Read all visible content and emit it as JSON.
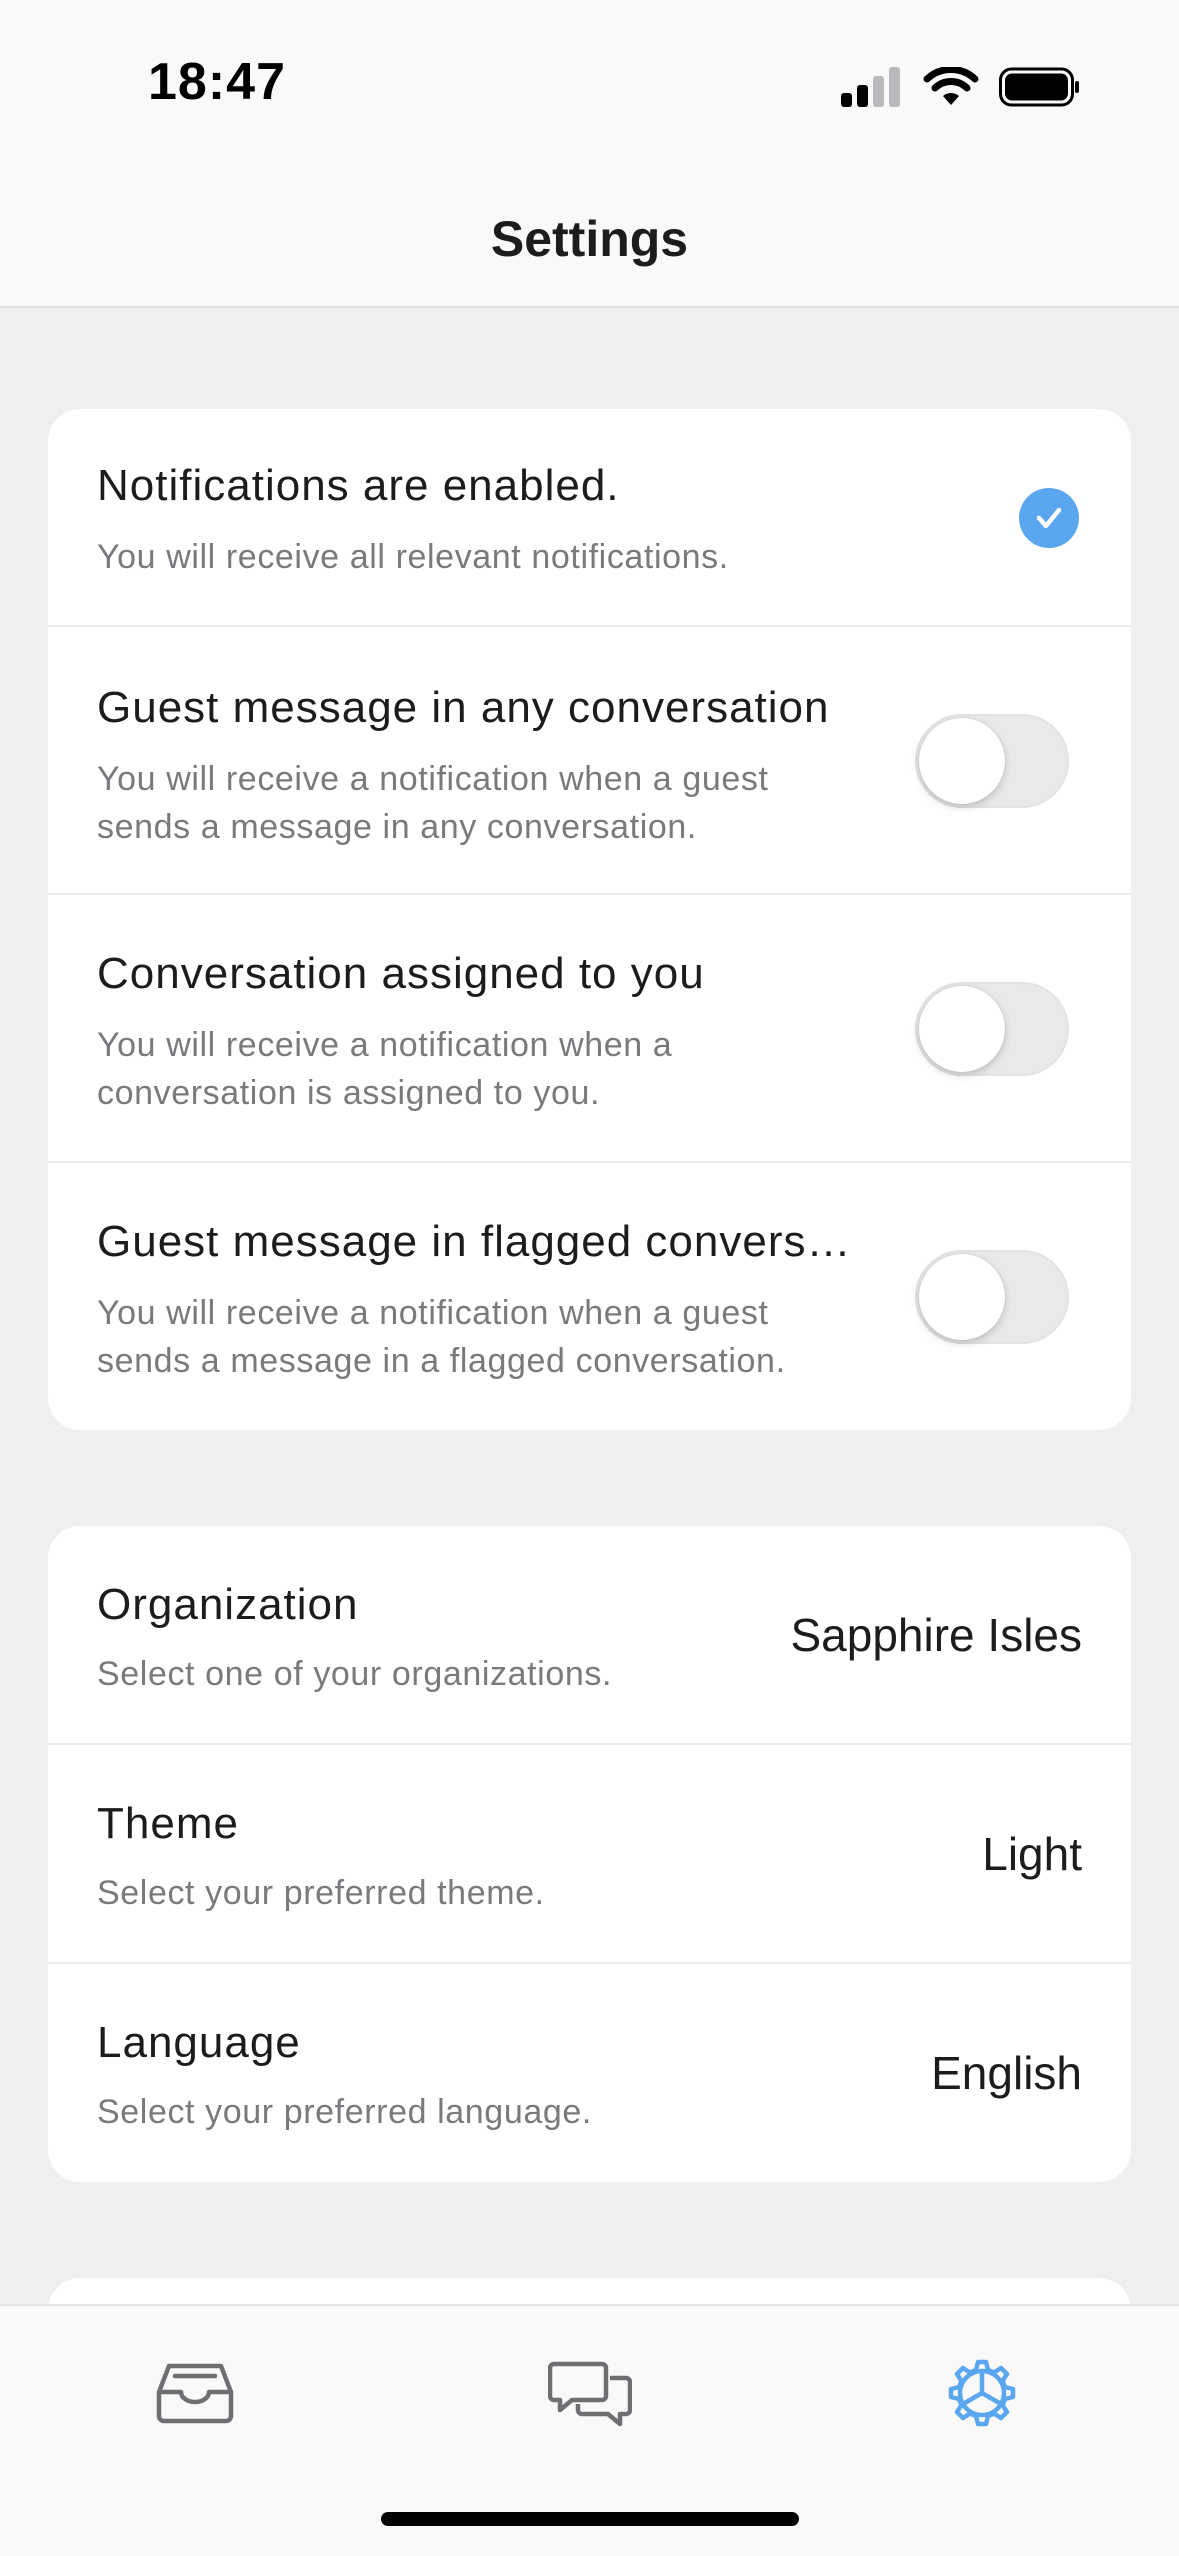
{
  "status_bar": {
    "time": "18:47"
  },
  "header": {
    "title": "Settings"
  },
  "notifications": {
    "status": {
      "title": "Notifications are enabled.",
      "subtitle": "You will receive all relevant notifications.",
      "enabled": true
    },
    "items": [
      {
        "title": "Guest message in any conversation",
        "subtitle_line1": "You will receive a notification when a guest",
        "subtitle_line2": "sends a message in any conversation.",
        "on": false
      },
      {
        "title": "Conversation assigned to you",
        "subtitle_line1": "You will receive a notification when a",
        "subtitle_line2": "conversation is assigned to you.",
        "on": false
      },
      {
        "title": "Guest message in flagged convers…",
        "subtitle_line1": "You will receive a notification when a guest",
        "subtitle_line2": "sends a message in a flagged conversation.",
        "on": false
      }
    ]
  },
  "preferences": {
    "organization": {
      "title": "Organization",
      "subtitle": "Select one of your organizations.",
      "value": "Sapphire Isles"
    },
    "theme": {
      "title": "Theme",
      "subtitle": "Select your preferred theme.",
      "value": "Light"
    },
    "language": {
      "title": "Language",
      "subtitle": "Select your preferred language.",
      "value": "English"
    }
  },
  "tabbar": {
    "tabs": [
      {
        "icon": "inbox-icon",
        "active": false
      },
      {
        "icon": "chat-bubbles-icon",
        "active": false
      },
      {
        "icon": "settings-gear-icon",
        "active": true
      }
    ]
  },
  "colors": {
    "accent": "#5aa7ef",
    "inactive_icon": "#6e6e73"
  }
}
